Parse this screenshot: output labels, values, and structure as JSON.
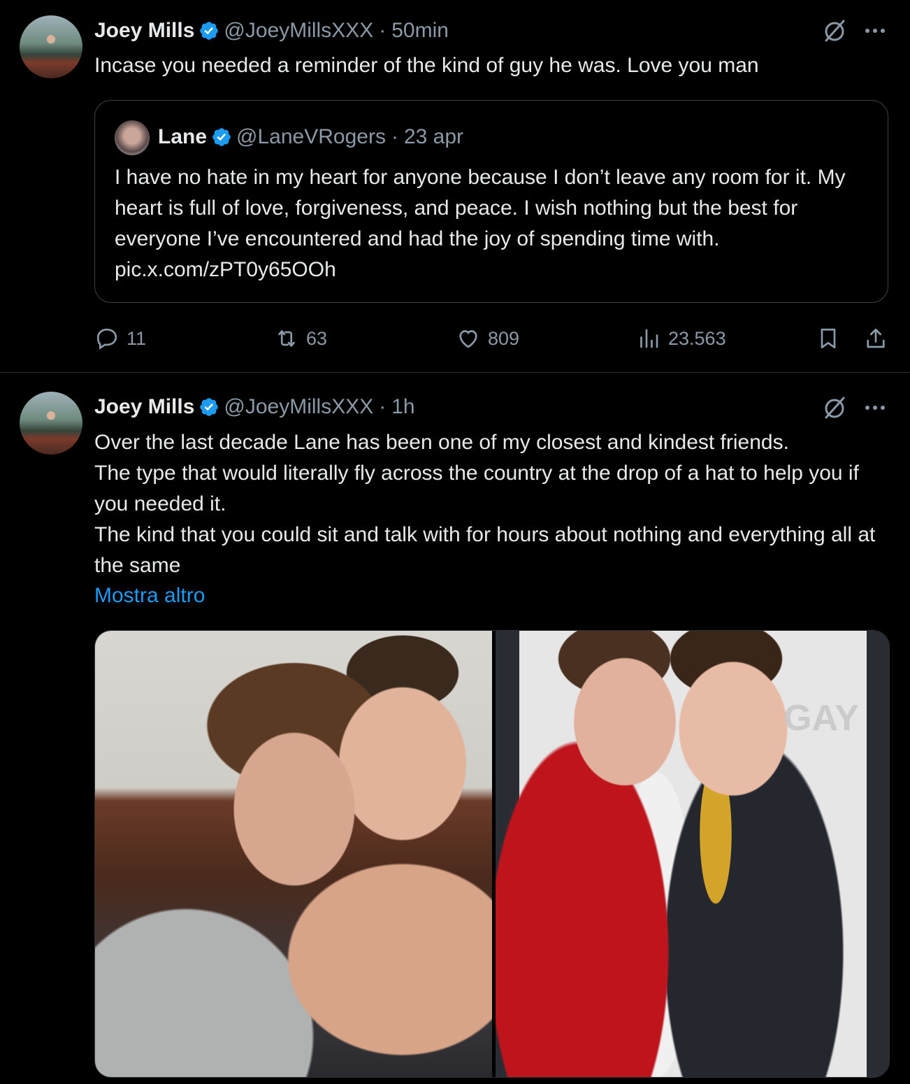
{
  "tweet1": {
    "author": {
      "name": "Joey Mills",
      "handle": "@JoeyMillsXXX",
      "time": "50min"
    },
    "text": "Incase you needed a reminder of the kind of guy he was. Love you man",
    "quote": {
      "author": {
        "name": "Lane",
        "handle": "@LaneVRogers",
        "time": "23 apr"
      },
      "text": "I have no hate in my heart for anyone because I don’t leave any room for it. My heart is full of love, forgiveness, and peace. I wish nothing but the best for everyone I’ve encountered and had the joy of spending time with. pic.x.com/zPT0y65OOh"
    },
    "actions": {
      "replies": "11",
      "reposts": "63",
      "likes": "809",
      "views": "23.563"
    }
  },
  "tweet2": {
    "author": {
      "name": "Joey Mills",
      "handle": "@JoeyMillsXXX",
      "time": "1h"
    },
    "text": "Over the last decade Lane has been one of my closest and kindest friends.\nThe type that would literally fly across the country at the drop of a hat to help you if you needed it.\nThe kind that you could sit and talk with for hours about nothing and everything all at the same",
    "show_more": "Mostra altro",
    "media": {
      "photo2_sign": "GAY"
    }
  },
  "separator": "·",
  "colors": {
    "background": "#000000",
    "text": "#e7e9ea",
    "muted": "#8b98a5",
    "link": "#1d9bf0",
    "verified": "#1d9bf0",
    "border": "#2f3336"
  }
}
